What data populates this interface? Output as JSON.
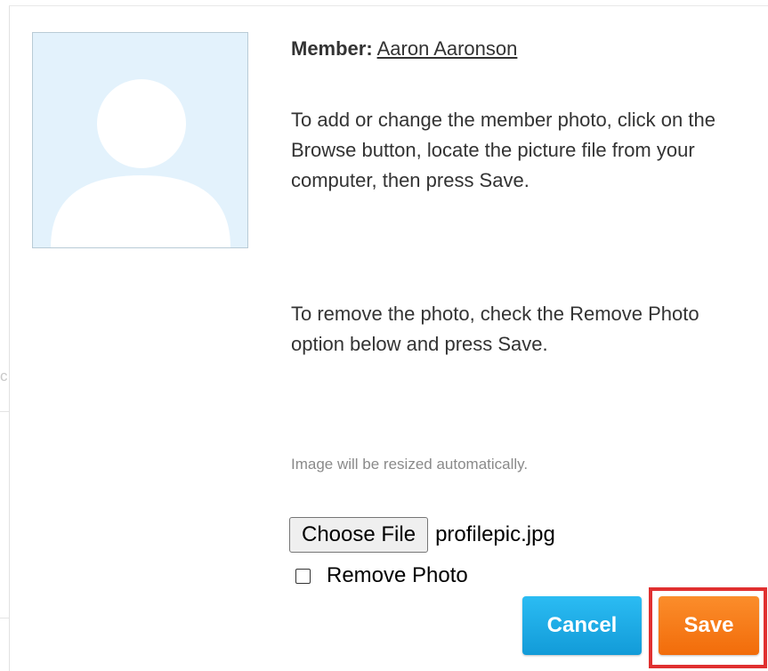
{
  "background": {
    "partial_letter": "c"
  },
  "member": {
    "label": "Member:",
    "name": "Aaron Aaronson"
  },
  "instructions": {
    "add_change": "To add or change the member photo, click on the Browse button, locate the picture file from your computer, then press Save.",
    "remove": "To remove the photo, check the Remove Photo option below and press Save.",
    "resize_note": "Image will be resized automatically."
  },
  "file_input": {
    "button_label": "Choose File",
    "selected_file": "profilepic.jpg"
  },
  "remove_photo": {
    "label": "Remove Photo",
    "checked": false
  },
  "buttons": {
    "cancel": "Cancel",
    "save": "Save"
  },
  "colors": {
    "avatar_bg": "#e3f2fc",
    "cancel": "#1aa9e4",
    "save": "#f7790f",
    "highlight": "#e03030"
  },
  "icons": {
    "avatar": "person-silhouette-icon"
  }
}
